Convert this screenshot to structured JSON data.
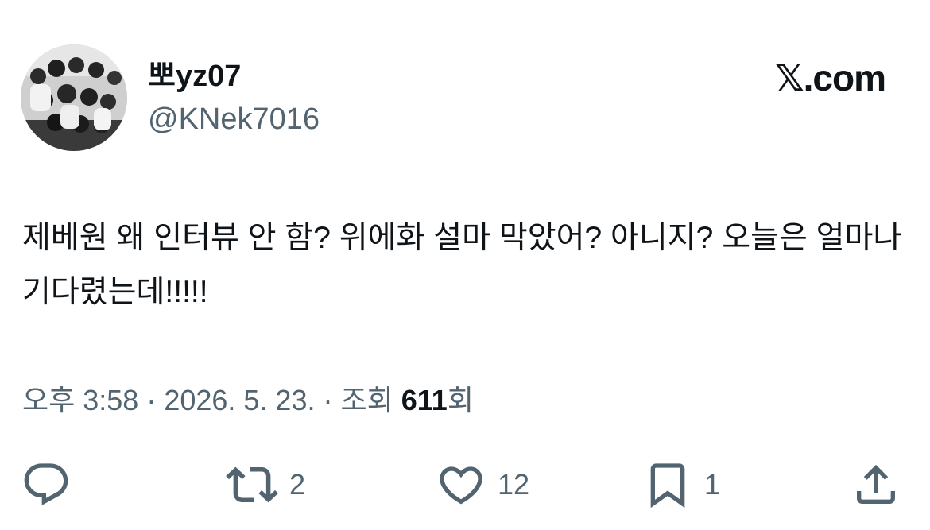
{
  "author": {
    "display_name": "뽀yz07",
    "handle": "@KNek7016",
    "avatar_icon": "group-photo-avatar"
  },
  "brand": {
    "label": "𝕏.com",
    "icon": "x-logo"
  },
  "tweet": {
    "text": "제베원 왜 인터뷰 안 함? 위에화 설마 막았어? 아니지? 오늘은 얼마나 기다렸는데!!!!!"
  },
  "meta": {
    "time": "오후 3:58",
    "separator": " · ",
    "date": "2026. 5. 23.",
    "views_prefix": "조회 ",
    "views_count": "611",
    "views_suffix": "회"
  },
  "actions": {
    "reply": {
      "icon": "reply-icon",
      "count": ""
    },
    "retweet": {
      "icon": "retweet-icon",
      "count": "2"
    },
    "like": {
      "icon": "heart-icon",
      "count": "12"
    },
    "bookmark": {
      "icon": "bookmark-icon",
      "count": "1"
    },
    "share": {
      "icon": "share-icon",
      "count": ""
    }
  },
  "colors": {
    "text": "#0f1419",
    "secondary": "#536471",
    "background": "#ffffff"
  }
}
